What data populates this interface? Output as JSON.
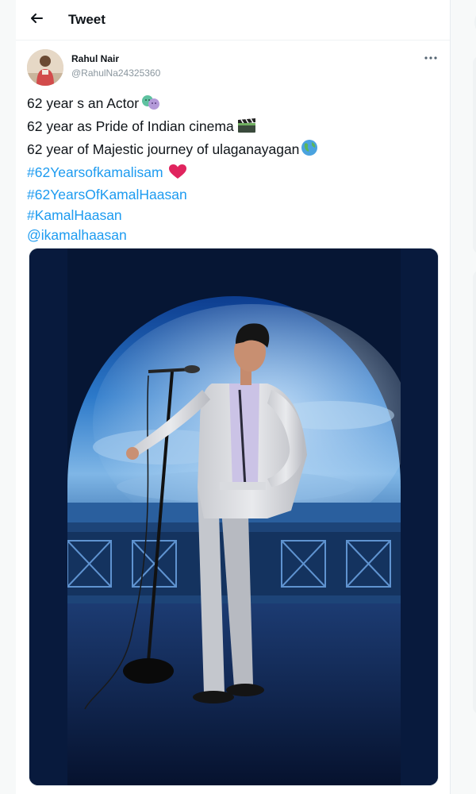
{
  "header": {
    "title": "Tweet",
    "back_icon": "arrow-left-icon"
  },
  "tweet": {
    "author": {
      "display_name": "Rahul Nair",
      "handle": "@RahulNa24325360"
    },
    "more_icon": "ellipsis-icon",
    "lines": [
      {
        "text": "62 year s an Actor",
        "emoji": "performing-arts-masks"
      },
      {
        "text": "62 year as Pride of Indian cinema",
        "emoji": "clapper-board"
      },
      {
        "text": "62 year of Majestic journey of ulaganayagan",
        "emoji": "globe"
      }
    ],
    "hashtags": [
      {
        "text": "#62Yearsofkamalisam",
        "emoji": "red-heart"
      },
      {
        "text": "#62YearsOfKamalHaasan"
      },
      {
        "text": "#KamalHaasan"
      }
    ],
    "mention": "@ikamalhaasan",
    "media": {
      "type": "photo",
      "subject": "man in white suit beside microphone stand under arch"
    }
  },
  "colors": {
    "link": "#1d9bf0",
    "text": "#0f1419",
    "secondary": "#8a969e",
    "heart": "#e0245e"
  }
}
